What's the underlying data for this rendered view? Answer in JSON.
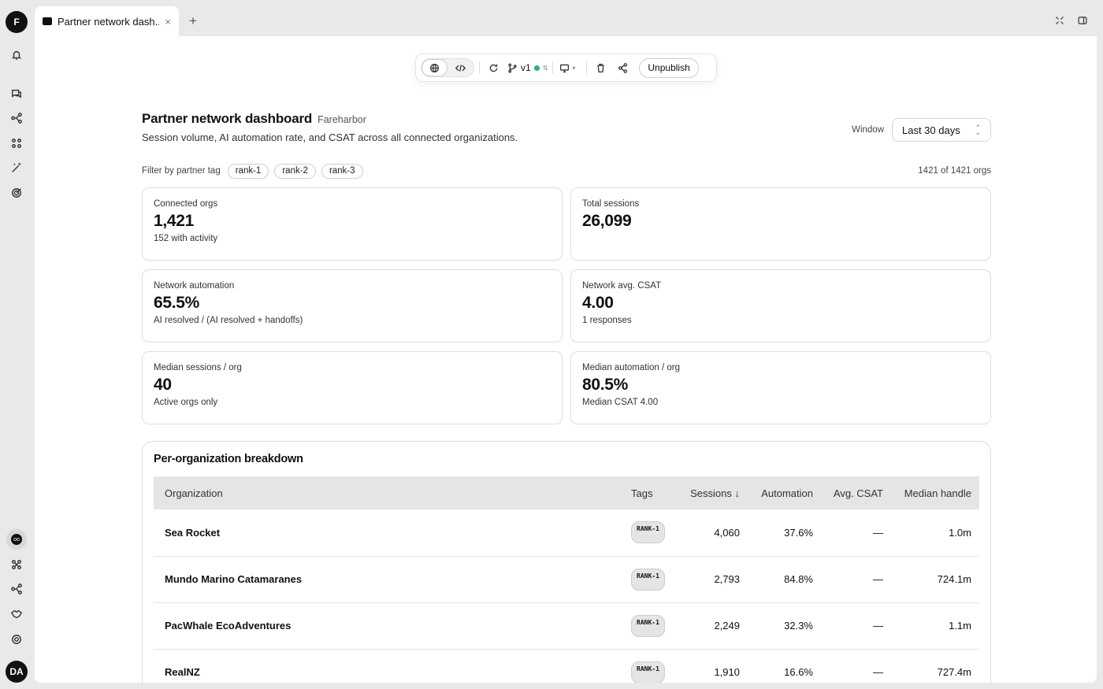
{
  "rail": {
    "workspace_initial": "F",
    "user_initials": "DA"
  },
  "tab": {
    "title": "Partner network dash...",
    "close": "×",
    "add": "+"
  },
  "toolbar": {
    "version": "v1",
    "version_status_color": "#22b573",
    "unpublish_label": "Unpublish"
  },
  "header": {
    "title": "Partner network dashboard",
    "org": "Fareharbor",
    "subtitle": "Session volume, AI automation rate, and CSAT across all connected organizations.",
    "window_label": "Window",
    "window_value": "Last 30 days"
  },
  "filters": {
    "label": "Filter by partner tag",
    "tags": [
      "rank-1",
      "rank-2",
      "rank-3"
    ],
    "count": "1421 of 1421 orgs"
  },
  "cards": [
    {
      "label": "Connected orgs",
      "value": "1,421",
      "note": "152 with activity"
    },
    {
      "label": "Total sessions",
      "value": "26,099",
      "note": ""
    },
    {
      "label": "Network automation",
      "value": "65.5%",
      "note": "AI resolved / (AI resolved + handoffs)"
    },
    {
      "label": "Network avg. CSAT",
      "value": "4.00",
      "note": "1 responses"
    },
    {
      "label": "Median sessions / org",
      "value": "40",
      "note": "Active orgs only"
    },
    {
      "label": "Median automation / org",
      "value": "80.5%",
      "note": "Median CSAT 4.00"
    }
  ],
  "breakdown": {
    "title": "Per-organization breakdown",
    "columns": {
      "org": "Organization",
      "tags": "Tags",
      "sessions": "Sessions ↓",
      "automation": "Automation",
      "csat": "Avg. CSAT",
      "handle": "Median handle"
    },
    "rows": [
      {
        "org": "Sea Rocket",
        "tag": "RANK-1",
        "sessions": "4,060",
        "automation": "37.6%",
        "csat": "—",
        "handle": "1.0m"
      },
      {
        "org": "Mundo Marino Catamaranes",
        "tag": "RANK-1",
        "sessions": "2,793",
        "automation": "84.8%",
        "csat": "—",
        "handle": "724.1m"
      },
      {
        "org": "PacWhale EcoAdventures",
        "tag": "RANK-1",
        "sessions": "2,249",
        "automation": "32.3%",
        "csat": "—",
        "handle": "1.1m"
      },
      {
        "org": "RealNZ",
        "tag": "RANK-1",
        "sessions": "1,910",
        "automation": "16.6%",
        "csat": "—",
        "handle": "727.4m"
      }
    ]
  }
}
